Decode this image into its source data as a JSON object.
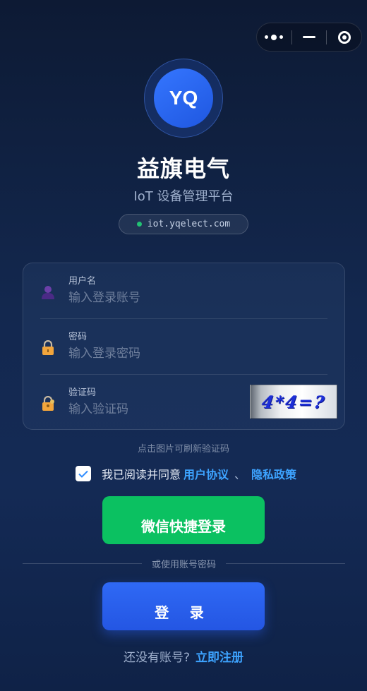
{
  "capsule": {
    "more_icon": "more-dots-icon",
    "minimize_icon": "minimize-icon",
    "close_icon": "target-close-icon"
  },
  "header": {
    "logo_text": "YQ",
    "brand": "益旗电气",
    "subtitle": "IoT 设备管理平台",
    "domain": "iot.yqelect.com"
  },
  "form": {
    "username": {
      "label": "用户名",
      "placeholder": "输入登录账号",
      "value": ""
    },
    "password": {
      "label": "密码",
      "placeholder": "输入登录密码",
      "value": ""
    },
    "captcha": {
      "label": "验证码",
      "placeholder": "输入验证码",
      "value": "",
      "image_text": "4*4=?"
    },
    "captcha_hint": "点击图片可刷新验证码"
  },
  "agreement": {
    "checked": true,
    "text": "我已阅读并同意",
    "user_agreement": "用户协议",
    "separator": "、",
    "privacy_policy": "隐私政策"
  },
  "buttons": {
    "wechat_login": "微信快捷登录",
    "or_divider": "或使用账号密码",
    "login": "登 录"
  },
  "register": {
    "question": "还没有账号?",
    "link": "立即注册"
  },
  "colors": {
    "accent_blue": "#2456e3",
    "wechat_green": "#0bc161",
    "link_blue": "#3da3ff"
  }
}
